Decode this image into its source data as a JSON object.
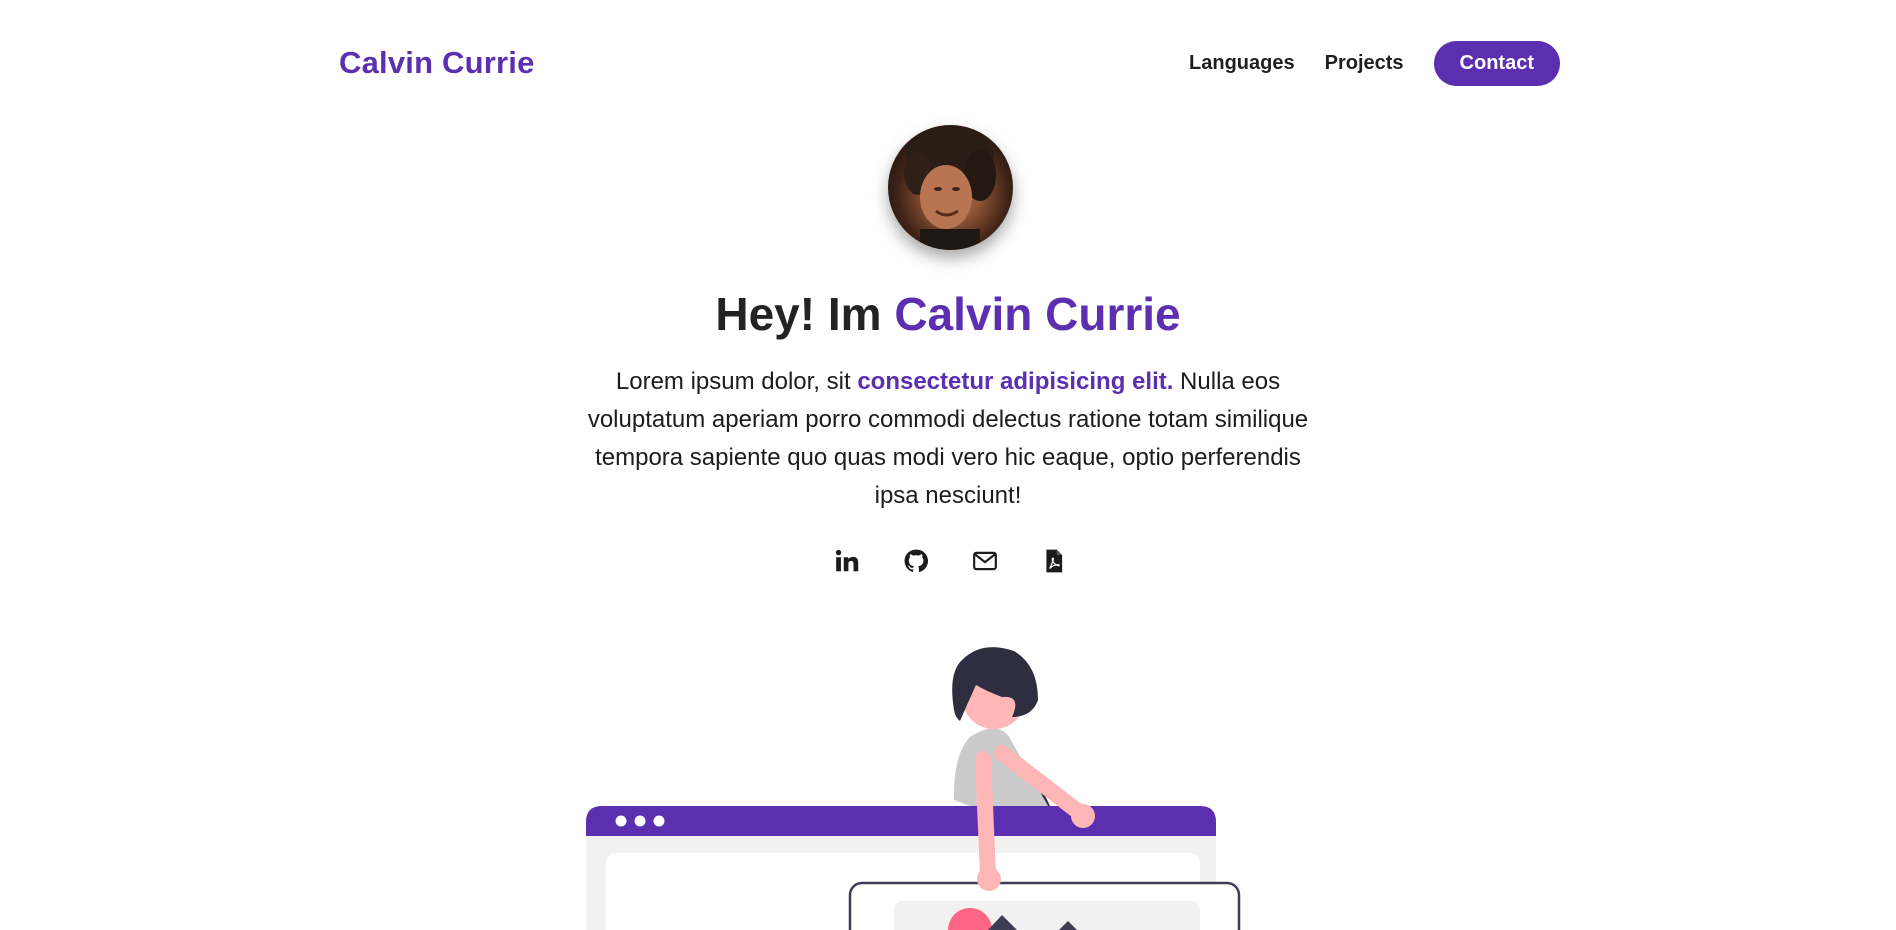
{
  "brand": {
    "name": "Calvin Currie"
  },
  "nav": {
    "languages": "Languages",
    "projects": "Projects",
    "contact": "Contact"
  },
  "hero": {
    "greeting": "Hey! Im",
    "name": "Calvin Currie",
    "bio_before": "Lorem ipsum dolor, sit ",
    "bio_highlight": "consectetur adipisicing elit.",
    "bio_after": " Nulla eos voluptatum aperiam porro commodi delectus ratione totam similique tempora sapiente quo quas modi vero hic eaque, optio perferendis ipsa nesciunt!"
  },
  "socials": [
    {
      "icon": "linkedin-icon"
    },
    {
      "icon": "github-icon"
    },
    {
      "icon": "envelope-icon"
    },
    {
      "icon": "pdf-icon"
    }
  ],
  "colors": {
    "accent": "#5b2fb0",
    "text": "#1f1f1f",
    "background": "#ffffff"
  }
}
